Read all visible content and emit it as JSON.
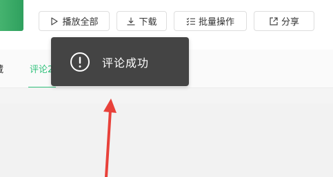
{
  "toolbar": {
    "play_all_label": "播放全部",
    "download_label": "下载",
    "batch_label": "批量操作",
    "share_label": "分享"
  },
  "tabs": [
    {
      "label": "藏"
    },
    {
      "label": "评论2"
    }
  ],
  "toast": {
    "message": "评论成功",
    "icon": "exclamation-circle-icon"
  },
  "icons": {
    "play": "play-icon",
    "download": "download-icon",
    "batch": "batch-list-icon",
    "share": "share-icon"
  },
  "colors": {
    "accent": "#31c27c",
    "toast_bg": "#3a3a3a",
    "arrow": "#e8413a",
    "cover": "#3aaa66"
  }
}
